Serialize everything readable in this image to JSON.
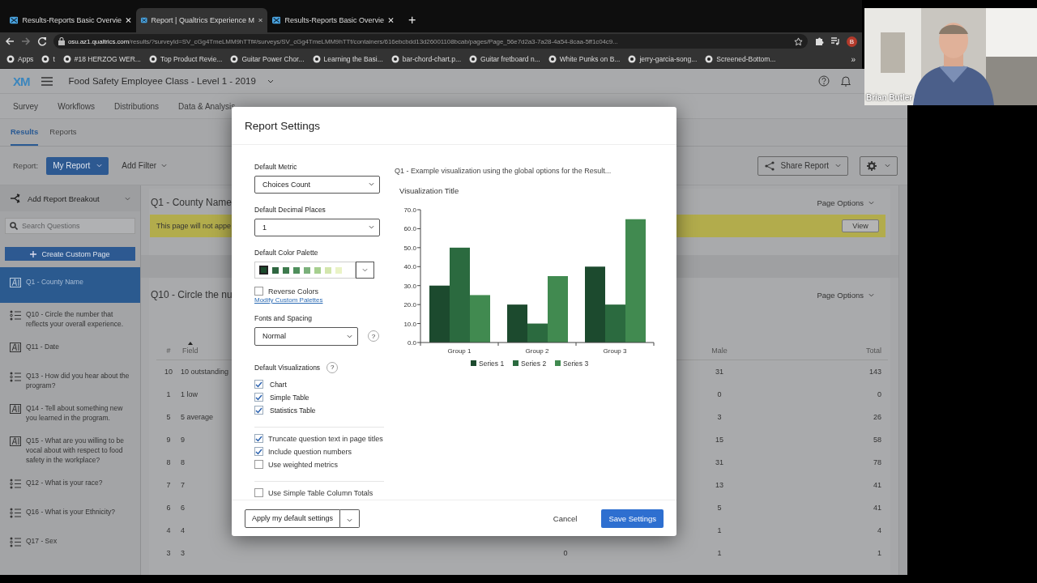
{
  "browser": {
    "tabs": [
      {
        "title": "Results-Reports Basic Overvie",
        "selected": false
      },
      {
        "title": "Report | Qualtrics Experience M",
        "selected": true
      },
      {
        "title": "Results-Reports Basic Overvie",
        "selected": false
      }
    ],
    "new_tab": "+",
    "url_host": "osu.az1.qualtrics.com",
    "url_path": "/results/?surveyId=SV_cGg4TmeLMM9hTTf#/surveys/SV_cGg4TmeLMM9hTTf/containers/616ebcbdd13d26001108bcab/pages/Page_56e7d2a3-7a28-4a54-8caa-5ff1c04c9...",
    "profile": "B",
    "bookmarks": [
      "Apps",
      "t",
      "#18 HERZOG WER...",
      "Top Product Revie...",
      "Guitar Power Chor...",
      "Learning the Basi...",
      "bar-chord-chart.p...",
      "Guitar fretboard n...",
      "White Punks on B...",
      "jerry-garcia-song...",
      "Screened-Bottom..."
    ],
    "bookmarks_more": "»"
  },
  "app": {
    "logo": "XM",
    "project_title": "Food Safety Employee Class - Level 1 - 2019",
    "nav": [
      "Survey",
      "Workflows",
      "Distributions",
      "Data & Analysis"
    ],
    "subtabs": [
      {
        "label": "Results",
        "selected": true
      },
      {
        "label": "Reports",
        "selected": false
      }
    ],
    "report_label": "Report:",
    "report_button": "My Report",
    "add_filter": "Add Filter",
    "share_button": "Share Report"
  },
  "sidebar": {
    "breakout": "Add Report Breakout",
    "search_placeholder": "Search Questions",
    "create_button": "Create Custom Page",
    "items": [
      {
        "label": "Q1 - County Name",
        "kind": "text",
        "selected": true
      },
      {
        "label": "Q10 - Circle the number that reflects your overall experience.",
        "kind": "choice",
        "selected": false
      },
      {
        "label": "Q11 - Date",
        "kind": "text",
        "selected": false
      },
      {
        "label": "Q13 - How did you hear about the program?",
        "kind": "choice",
        "selected": false
      },
      {
        "label": "Q14 - Tell about something new you learned in the program.",
        "kind": "text",
        "selected": false
      },
      {
        "label": "Q15 - What are you willing to be vocal about with respect to food safety in the workplace?",
        "kind": "text",
        "selected": false
      },
      {
        "label": "Q12 - What is your race?",
        "kind": "choice",
        "selected": false
      },
      {
        "label": "Q16 - What is your Ethnicity?",
        "kind": "choice",
        "selected": false
      },
      {
        "label": "Q17 - Sex",
        "kind": "choice",
        "selected": false
      }
    ]
  },
  "pages": [
    {
      "title": "Q1 - County Name",
      "options": "Page Options",
      "notice": "This page will not appe",
      "notice_button": "View"
    },
    {
      "title": "Q10 - Circle the nu",
      "options": "Page Options",
      "table": {
        "columns": [
          "#",
          "Field",
          "Male",
          "Total"
        ],
        "rows": [
          {
            "number": "10",
            "field": "10 outstanding",
            "male": "31",
            "total": "143"
          },
          {
            "number": "1",
            "field": "1 low",
            "male": "0",
            "total": "0"
          },
          {
            "number": "5",
            "field": "5 average",
            "male": "3",
            "total": "26"
          },
          {
            "number": "9",
            "field": "9",
            "male": "15",
            "total": "58"
          },
          {
            "number": "8",
            "field": "8",
            "male": "31",
            "total": "78"
          },
          {
            "number": "7",
            "field": "7",
            "male": "13",
            "total": "41"
          },
          {
            "number": "6",
            "field": "6",
            "male": "5",
            "total": "41"
          },
          {
            "number": "4",
            "field": "4",
            "male": "1",
            "total": "4"
          },
          {
            "number": "3",
            "field": "3",
            "column_3": "0",
            "male": "1",
            "total": "1"
          }
        ]
      }
    }
  ],
  "dialog": {
    "title": "Report Settings",
    "metric": {
      "label": "Default Metric",
      "value": "Choices Count"
    },
    "decimals": {
      "label": "Default Decimal Places",
      "value": "1"
    },
    "palette": {
      "label": "Default Color Palette",
      "swatches": [
        {
          "color": "#1b4a2c",
          "selected": true
        },
        {
          "color": "#2e6640",
          "selected": false
        },
        {
          "color": "#3d7a4d",
          "selected": false
        },
        {
          "color": "#4f8f5c",
          "selected": false
        },
        {
          "color": "#7ab07a",
          "selected": false
        },
        {
          "color": "#a6cf8f",
          "selected": false
        },
        {
          "color": "#d3e6ad",
          "selected": false
        },
        {
          "color": "#eaf3c6",
          "selected": false
        }
      ]
    },
    "reverse_colors": {
      "label": "Reverse Colors",
      "checked": false
    },
    "modify_link": "Modify Custom Palettes",
    "fonts": {
      "label": "Fonts and Spacing",
      "value": "Normal",
      "help": "?"
    },
    "visualizations": {
      "label": "Default Visualizations",
      "help": "?",
      "options": [
        {
          "label": "Chart",
          "checked": true
        },
        {
          "label": "Simple Table",
          "checked": true
        },
        {
          "label": "Statistics Table",
          "checked": true
        }
      ]
    },
    "options": [
      {
        "label": "Truncate question text in page titles",
        "checked": true
      },
      {
        "label": "Include question numbers",
        "checked": true
      },
      {
        "label": "Use weighted metrics",
        "checked": false
      }
    ],
    "more_options": [
      {
        "label": "Use Simple Table Column Totals",
        "checked": false
      }
    ],
    "preview_caption": "Q1 - Example visualization using the global options for the Result...",
    "chart_data": {
      "type": "bar",
      "title": "Visualization Title",
      "categories": [
        "Group 1",
        "Group 2",
        "Group 3"
      ],
      "series": [
        {
          "name": "Series 1",
          "color": "#1c4a2e",
          "values": [
            30,
            20,
            40
          ]
        },
        {
          "name": "Series 2",
          "color": "#2b6a3f",
          "values": [
            50,
            10,
            20
          ]
        },
        {
          "name": "Series 3",
          "color": "#418a50",
          "values": [
            25,
            35,
            65
          ]
        }
      ],
      "ylim": [
        0,
        70
      ],
      "legend": "bottom",
      "yticks": [
        {
          "value": 0,
          "label": "0.0"
        },
        {
          "value": 10,
          "label": "10.0"
        },
        {
          "value": 20,
          "label": "20.0"
        },
        {
          "value": 30,
          "label": "30.0"
        },
        {
          "value": 40,
          "label": "40.0"
        },
        {
          "value": 50,
          "label": "50.0"
        },
        {
          "value": 60,
          "label": "60.0"
        },
        {
          "value": 70,
          "label": "70.0"
        }
      ]
    },
    "apply_button": "Apply my default settings",
    "cancel_button": "Cancel",
    "save_button": "Save Settings"
  },
  "video_overlay": {
    "kind": "picture",
    "name": "Brian Butler"
  }
}
